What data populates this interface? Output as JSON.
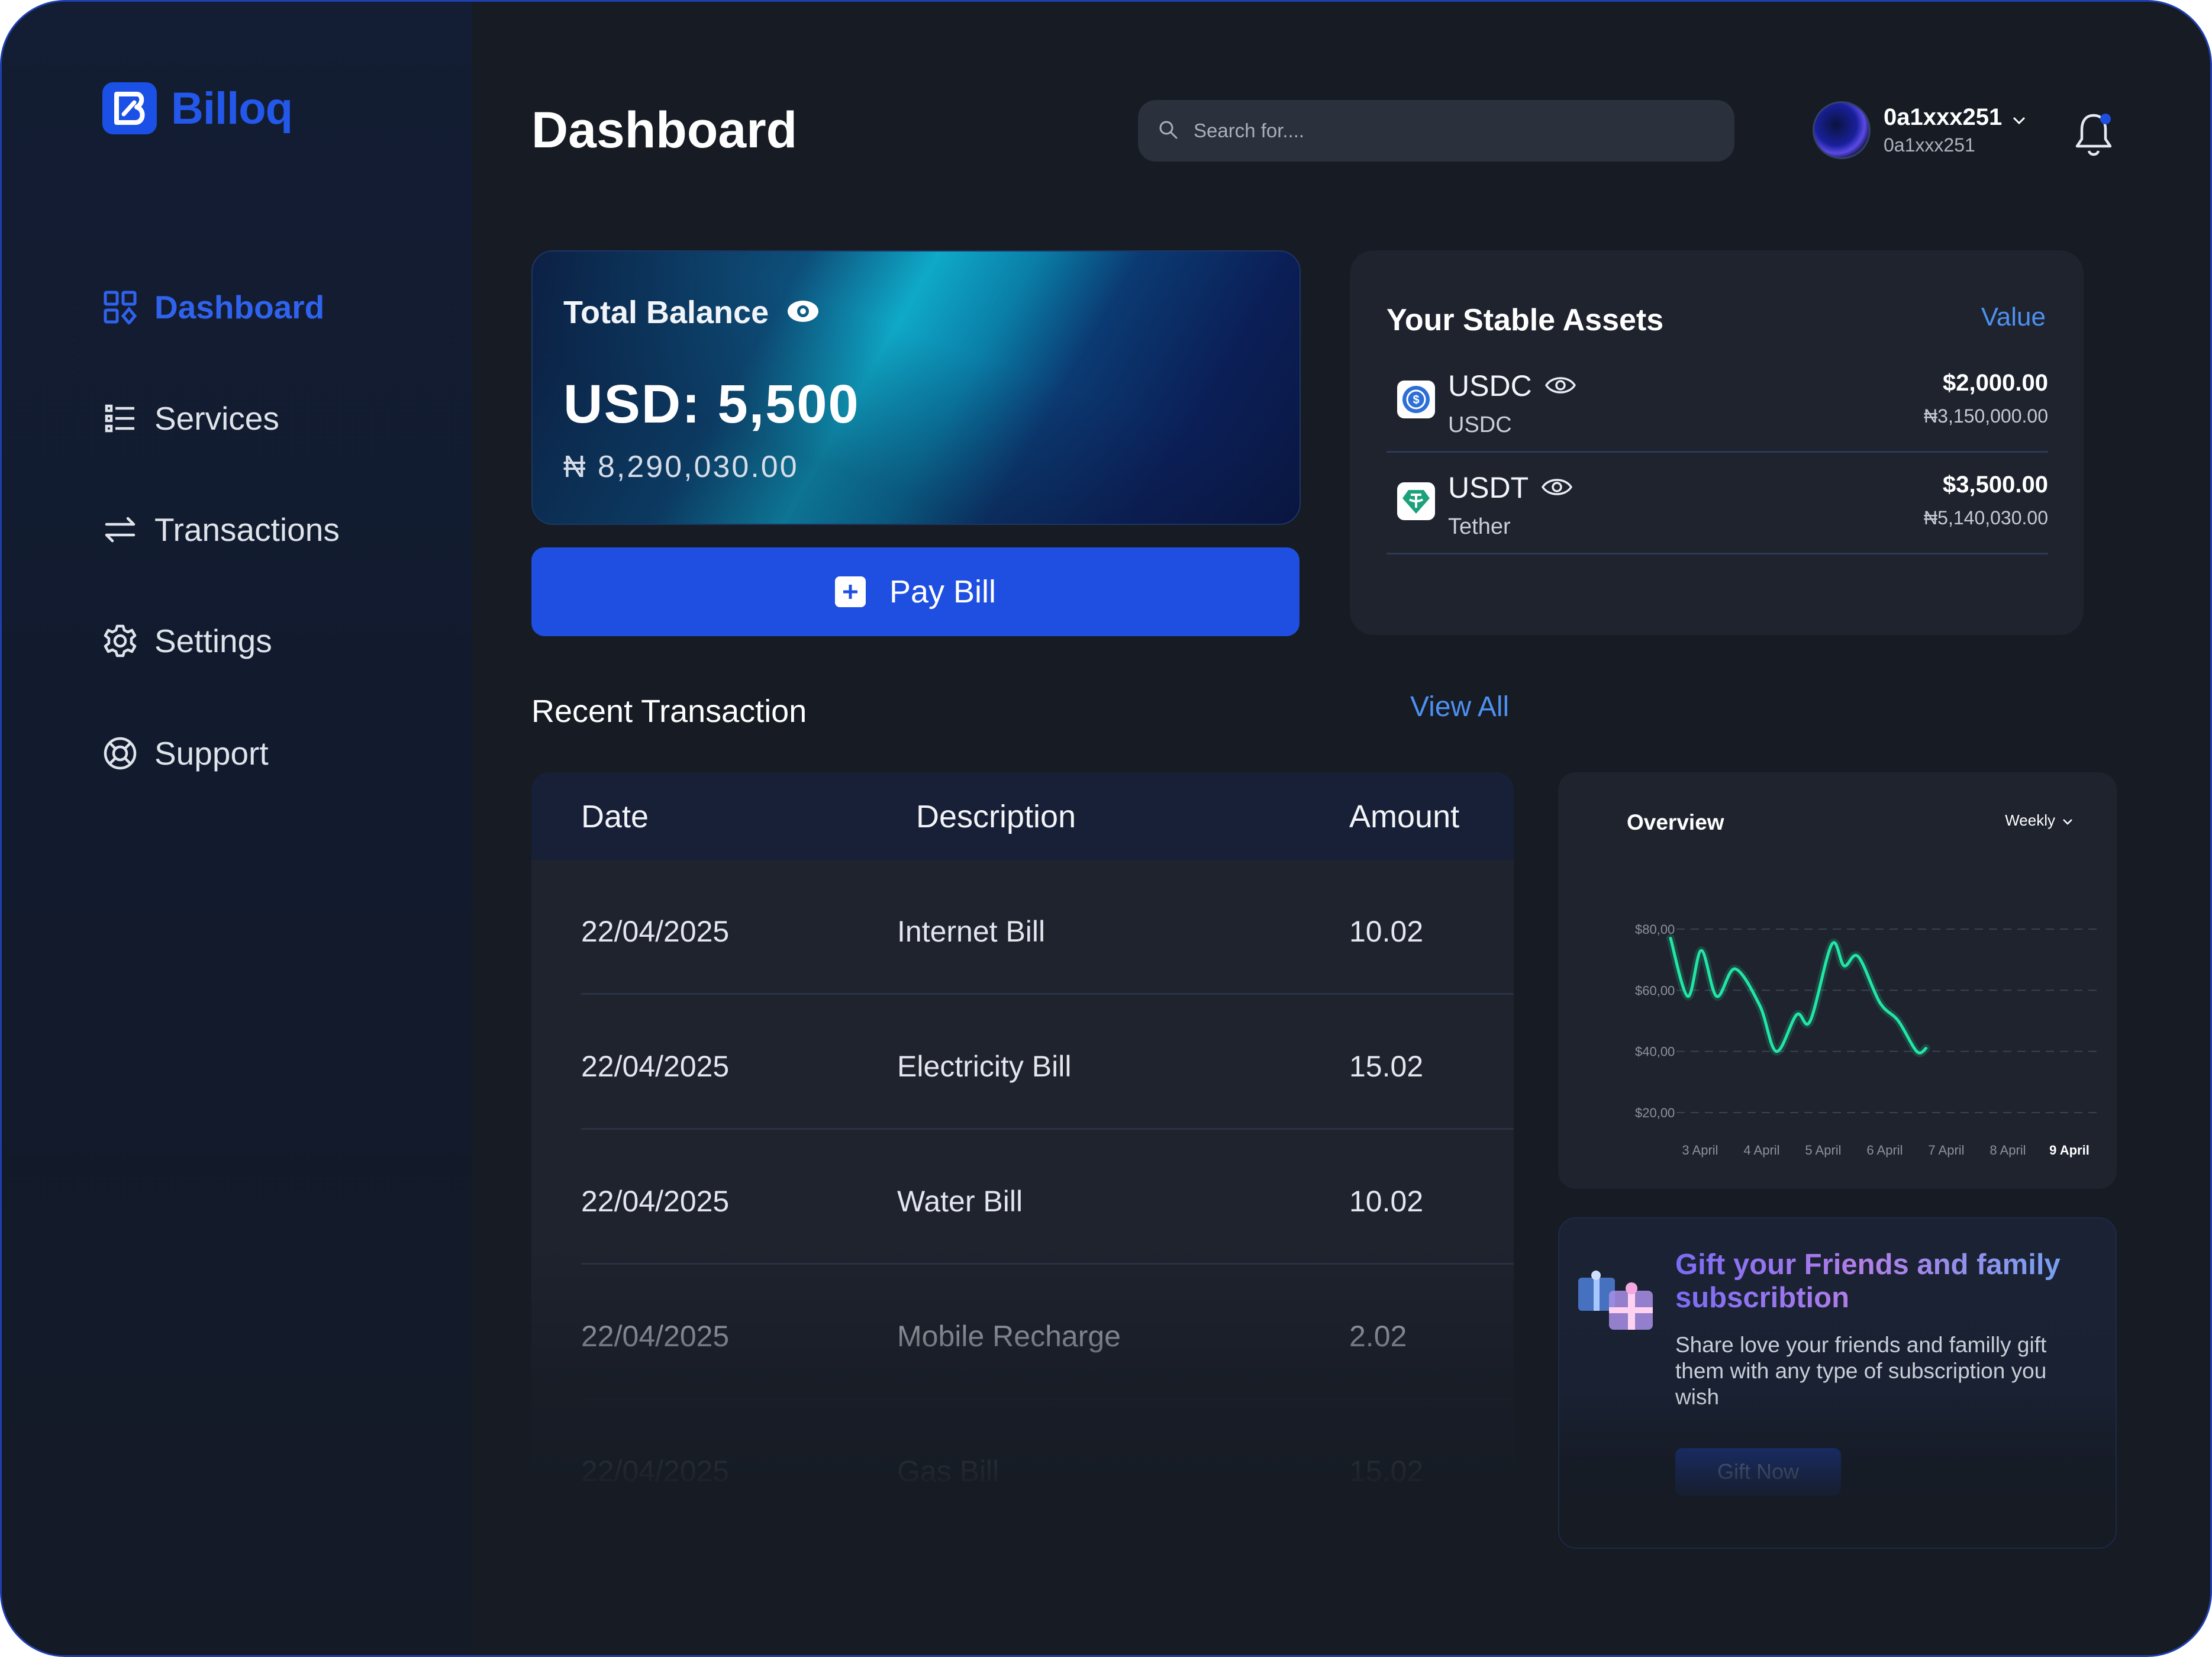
{
  "app": {
    "name": "Billoq",
    "brand_color": "#1f4fe0",
    "accent_color": "#4e90f0"
  },
  "sidebar": {
    "items": [
      {
        "label": "Dashboard",
        "icon": "grid-icon",
        "active": true
      },
      {
        "label": "Services",
        "icon": "list-icon",
        "active": false
      },
      {
        "label": "Transactions",
        "icon": "arrows-swap-icon",
        "active": false
      },
      {
        "label": "Settings",
        "icon": "gear-icon",
        "active": false
      },
      {
        "label": "Support",
        "icon": "lifebuoy-icon",
        "active": false
      }
    ]
  },
  "header": {
    "title": "Dashboard",
    "search_placeholder": "Search for....",
    "user": {
      "name": "0a1xxx251",
      "sub": "0a1xxx251"
    },
    "notification_dot_color": "#1f4fe0"
  },
  "balance": {
    "label": "Total Balance",
    "usd": "USD: 5,500",
    "ngn": "₦ 8,290,030.00"
  },
  "pay_bill": {
    "label": "Pay Bill"
  },
  "assets": {
    "title": "Your Stable Assets",
    "link": "Value",
    "items": [
      {
        "symbol": "USDC",
        "name": "USDC",
        "value": "$2,000.00",
        "ngn": "₦3,150,000.00",
        "icon": "usdc-coin-icon"
      },
      {
        "symbol": "USDT",
        "name": "Tether",
        "value": "$3,500.00",
        "ngn": "₦5,140,030.00",
        "icon": "tether-coin-icon"
      }
    ]
  },
  "transactions": {
    "title": "Recent Transaction",
    "view_all": "View All",
    "columns": [
      "Date",
      "Description",
      "Amount"
    ],
    "rows": [
      {
        "date": "22/04/2025",
        "description": "Internet Bill",
        "amount": "10.02"
      },
      {
        "date": "22/04/2025",
        "description": "Electricity Bill",
        "amount": "15.02"
      },
      {
        "date": "22/04/2025",
        "description": "Water Bill",
        "amount": "10.02"
      },
      {
        "date": "22/04/2025",
        "description": "Mobile Recharge",
        "amount": "2.02"
      },
      {
        "date": "22/04/2025",
        "description": "Gas Bill",
        "amount": "15.02"
      }
    ]
  },
  "overview": {
    "title": "Overview",
    "period": "Weekly"
  },
  "chart_data": {
    "type": "line",
    "title": "Overview",
    "x": [
      "3 April",
      "4 April",
      "5 April",
      "6 April",
      "7 April",
      "8 April",
      "9 April"
    ],
    "highlighted_x": "9 April",
    "y_ticks": [
      "$80,00",
      "$60,00",
      "$40,00",
      "$20,00"
    ],
    "ylim": [
      20,
      80
    ],
    "grid": true,
    "line_color": "#22e6a4",
    "series": [
      {
        "points": [
          [
            0.0,
            77
          ],
          [
            0.28,
            58
          ],
          [
            0.5,
            73
          ],
          [
            0.75,
            58
          ],
          [
            1.05,
            67
          ],
          [
            1.45,
            55
          ],
          [
            1.72,
            40
          ],
          [
            2.05,
            52
          ],
          [
            2.27,
            50
          ],
          [
            2.62,
            75
          ],
          [
            2.82,
            68
          ],
          [
            3.05,
            71
          ],
          [
            3.4,
            56
          ],
          [
            3.7,
            50
          ],
          [
            4.0,
            40
          ],
          [
            4.15,
            41
          ]
        ]
      }
    ]
  },
  "gift": {
    "title": "Gift your Friends and family subscribtion",
    "text": "Share love your friends and familly gift them with any type of subscription you wish",
    "button": "Gift Now"
  }
}
